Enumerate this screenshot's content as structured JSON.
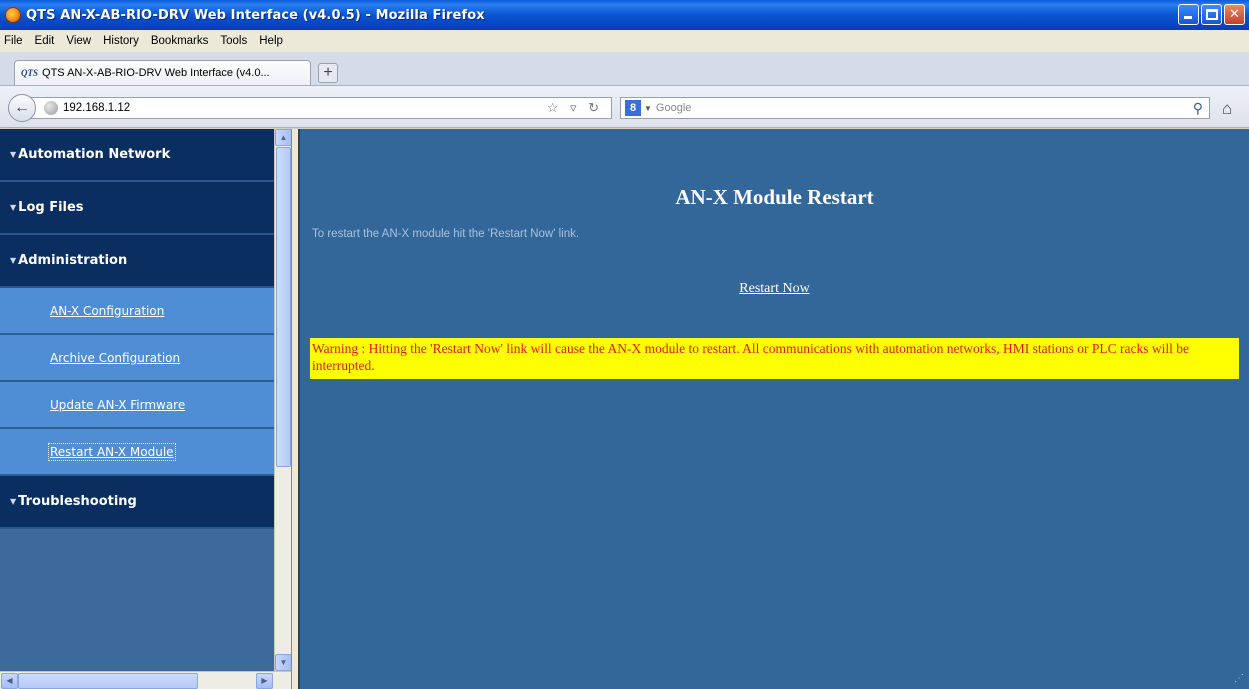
{
  "window": {
    "title": "QTS AN-X-AB-RIO-DRV Web Interface (v4.0.5) - Mozilla Firefox",
    "controls": [
      "minimize",
      "maximize",
      "close"
    ]
  },
  "menubar": {
    "items": [
      "File",
      "Edit",
      "View",
      "History",
      "Bookmarks",
      "Tools",
      "Help"
    ]
  },
  "tab": {
    "favicon_text": "QTS",
    "label": "QTS AN-X-AB-RIO-DRV Web Interface (v4.0...",
    "new_tab_label": "+"
  },
  "navbar": {
    "back_label": "←",
    "url": "192.168.1.12",
    "url_icons": "☆ ▿ ↻",
    "search_engine_icon": "8",
    "search_placeholder": "Google",
    "search_icon": "magnifier-icon",
    "home_icon": "home-icon"
  },
  "sidebar": {
    "categories": [
      {
        "label": "Automation Network"
      },
      {
        "label": "Log Files"
      },
      {
        "label": "Administration"
      },
      {
        "label": "Troubleshooting"
      }
    ],
    "admin_items": [
      {
        "label": "AN-X Configuration"
      },
      {
        "label": "Archive Configuration"
      },
      {
        "label": "Update AN-X Firmware"
      },
      {
        "label": "Restart AN-X Module"
      }
    ],
    "active_item": "Restart AN-X Module"
  },
  "main": {
    "title": "AN-X Module Restart",
    "instruction": "To restart the AN-X module hit the 'Restart Now' link.",
    "restart_link": "Restart Now",
    "warning": "Warning : Hitting the 'Restart Now' link will cause the AN-X module to restart. All communications with automation networks, HMI stations or PLC racks will be interrupted."
  },
  "colors": {
    "content_bg": "#336699",
    "sidebar_category_bg": "#0a2e60",
    "sidebar_item_bg": "#4f8ed5",
    "warning_bg": "#ffff00",
    "warning_text": "#e01a1a"
  }
}
